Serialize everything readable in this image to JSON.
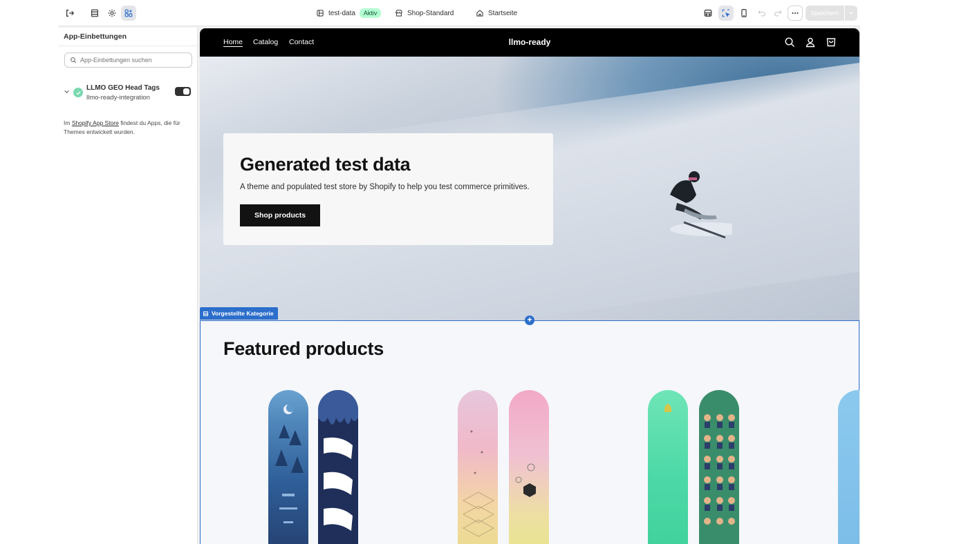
{
  "topbar": {
    "store": "test-data",
    "status_badge": "Aktiv",
    "theme": "Shop-Standard",
    "page": "Startseite",
    "save_label": "Speichern"
  },
  "sidebar": {
    "title": "App-Einbettungen",
    "search_placeholder": "App-Einbettungen suchen",
    "embed": {
      "name": "LLMO GEO Head Tags",
      "handle": "llmo-ready-integration",
      "enabled": true
    },
    "note_prefix": "Im ",
    "note_link": "Shopify App Store",
    "note_suffix": " findest du Apps, die für Themes entwickelt wurden."
  },
  "store": {
    "nav": [
      "Home",
      "Catalog",
      "Contact"
    ],
    "name": "llmo-ready",
    "hero": {
      "title": "Generated test data",
      "text": "A theme and populated test store by Shopify to help you test commerce primitives.",
      "button": "Shop products"
    },
    "section_tag": "Vorgestellte Kategorie",
    "featured_title": "Featured products"
  },
  "colors": {
    "accent": "#2c6ecb",
    "badge_bg": "#b4fed2",
    "store_header": "#000000"
  }
}
